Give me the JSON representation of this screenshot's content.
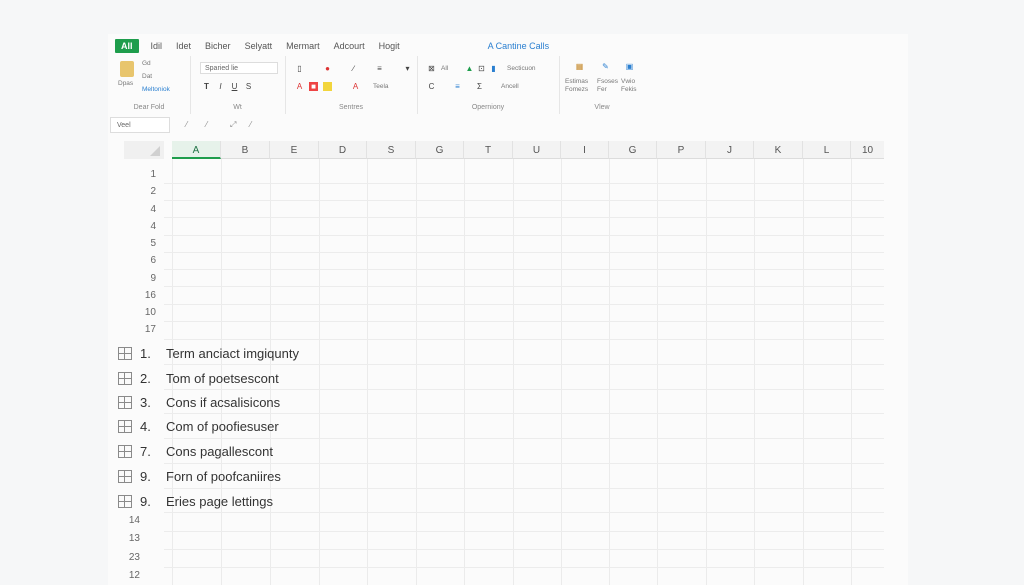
{
  "ribbon_tabs": [
    "All",
    "Idil",
    "Idet",
    "Bicher",
    "Selyatt",
    "Mermart",
    "Adcourt",
    "Hogit",
    "A Cantine Calls"
  ],
  "clipboard": {
    "paste": "Dpas",
    "cut": "Gd",
    "copy": "Dat",
    "painter": "Meltoniok",
    "label": "Dear Fold"
  },
  "font": {
    "name": "Sparied lie",
    "label": "Wt"
  },
  "alignment": {
    "wrap": "Teela",
    "label": "Sentres"
  },
  "numbers": {
    "all": "All",
    "section": "Secticuon",
    "accent": "Ancell",
    "label": "Operniony"
  },
  "view": {
    "formats": "Estimas Fomezs",
    "styles": "Fsoses Fer",
    "vwio": "Vwio Fekis",
    "label": "Vlew"
  },
  "formula_bar": {
    "name_box": "Veel"
  },
  "columns": [
    "A",
    "B",
    "E",
    "D",
    "S",
    "G",
    "T",
    "U",
    "I",
    "G",
    "P",
    "J",
    "K",
    "L",
    "10"
  ],
  "rows_top": [
    "1",
    "2",
    "4",
    "4",
    "5",
    "6",
    "9",
    "16",
    "10",
    "17"
  ],
  "list_items": [
    {
      "num": "1.",
      "text": "Term anciact imgiqunty"
    },
    {
      "num": "2.",
      "text": "Tom of poetsescont"
    },
    {
      "num": "3.",
      "text": "Cons if acsalisicons"
    },
    {
      "num": "4.",
      "text": "Com of poofiesuser"
    },
    {
      "num": "7.",
      "text": "Cons pagallescont"
    },
    {
      "num": "9.",
      "text": "Forn of poofcaniires"
    },
    {
      "num": "9.",
      "text": "Eries page lettings"
    }
  ],
  "rows_bottom": [
    "14",
    "13",
    "23",
    "12"
  ],
  "colors": {
    "accent": "#1e9d4c",
    "link": "#2a7fd0"
  }
}
